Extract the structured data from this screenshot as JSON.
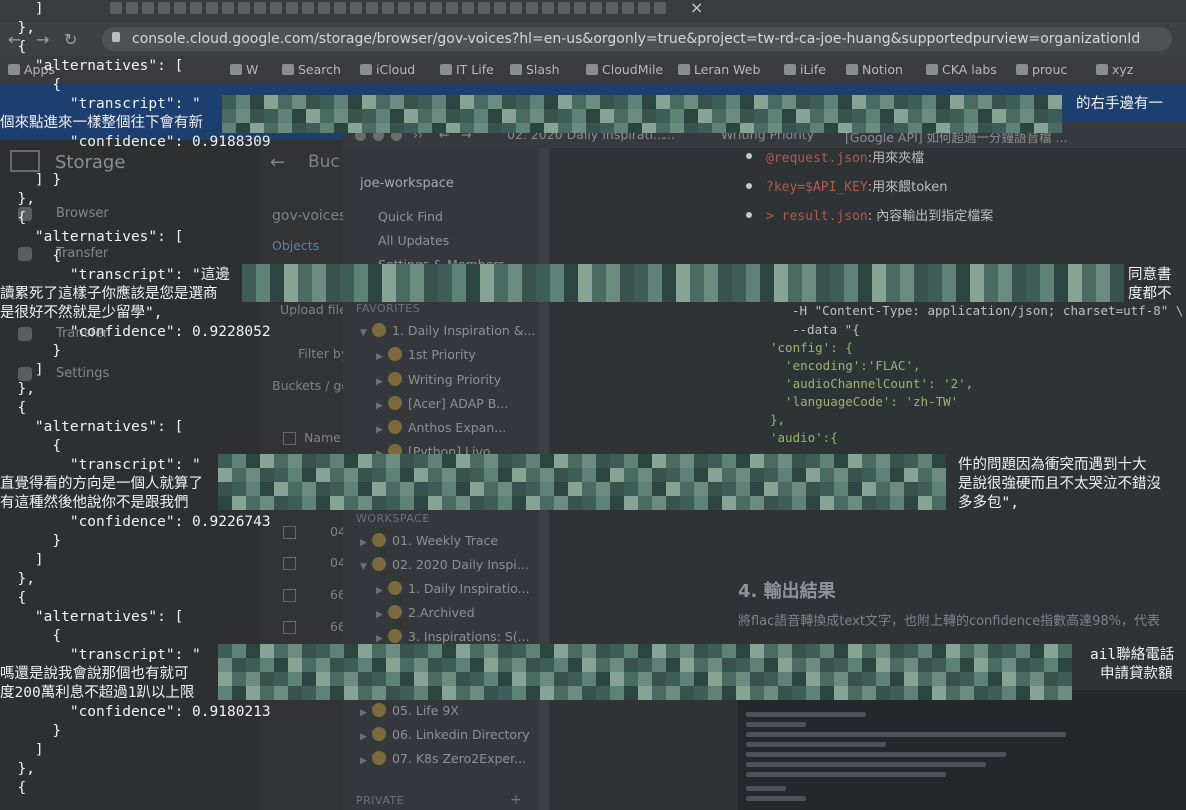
{
  "browser": {
    "url": "console.cloud.google.com/storage/browser/gov-voices?hl=en-us&orgonly=true&project=tw-rd-ca-joe-huang&supportedpurview=organizationId",
    "bookmarks": [
      "Apps",
      "W",
      "Search",
      "iCloud",
      "IT Life",
      "Slash",
      "CloudMile",
      "Leran Web",
      "iLife",
      "Notion",
      "CKA labs",
      "prouc",
      "xyz"
    ]
  },
  "gcs": {
    "title": "Storage",
    "section": "Buc",
    "bucket": "gov-voices",
    "nav": [
      "Browser",
      "Transfer",
      "Transfer",
      "Settings"
    ],
    "tabs": [
      "Objects"
    ],
    "upload": "Upload files",
    "filter": "Filter by",
    "crumb": "Buckets / go",
    "col_name": "Name",
    "rows": [
      "04",
      "04",
      "66",
      "66"
    ]
  },
  "notion": {
    "crumbs": [
      "02. 2020 Daily Inspirati...",
      "...",
      "Writing Priority",
      "[Google API] 如何超過一分鐘語音檔 ..."
    ],
    "workspace": "joe-workspace",
    "links": [
      "Quick Find",
      "All Updates",
      "Settings & Members"
    ],
    "section_favorites": "FAVORITES",
    "section_workspace": "WORKSPACE",
    "section_private": "PRIVATE",
    "tree": [
      "1. Daily Inspiration &...",
      "1st Priority",
      "Writing Priority",
      "[Acer] ADAP B...",
      "Anthos Expan...",
      "[Python] Livo...",
      "01. Weekly Trace",
      "02. 2020 Daily Inspi...",
      "1. Daily Inspiratio...",
      "2.Archived",
      "3. Inspirations: S(...",
      "05. Life 9X",
      "06. Linkedin Directory",
      "07. K8s Zero2Exper..."
    ],
    "bullets": [
      {
        "code": "@request.json",
        "text": ":用來夾檔"
      },
      {
        "code": "?key=$API_KEY",
        "text": ":用來餵token"
      },
      {
        "code": "> result.json",
        "text": ": 內容輸出到指定檔案"
      }
    ],
    "code_lines": [
      "-H \"Content-Type: application/json; charset=utf-8\" \\",
      "--data \"{",
      "'config': {",
      "  'encoding':'FLAC',",
      "  'audioChannelCount': '2',",
      "  'languageCode': 'zh-TW'",
      "},",
      "'audio':{"
    ],
    "heading": "4. 輸出結果",
    "para": "將flac語音轉換成text文字，也附上轉的confidence指數高達98%，代表"
  },
  "terminal": {
    "lines": [
      "    ]",
      "  },",
      "  {",
      "    \"alternatives\": [",
      "      {",
      "        \"transcript\": \"",
      "個來點進來一樣整個往下會有新",
      "        \"confidence\": 0.9188309",
      "      }",
      "    ]",
      "  },",
      "  {",
      "    \"alternatives\": [",
      "      {",
      "        \"transcript\": \"這邊",
      "讀累死了這樣子你應該是您是選商",
      "是很好不然就是少留學\",",
      "        \"confidence\": 0.9228052",
      "      }",
      "    ]",
      "  },",
      "  {",
      "    \"alternatives\": [",
      "      {",
      "        \"transcript\": \"",
      "直覺得看的方向是一個人就算了",
      "有這種然後他說你不是跟我們",
      "        \"confidence\": 0.9226743",
      "      }",
      "    ]",
      "  },",
      "  {",
      "    \"alternatives\": [",
      "      {",
      "        \"transcript\": \"",
      "嗎還是說我會說那個也有就可",
      "度200萬利息不超過1趴以上限",
      "        \"confidence\": 0.9180213",
      "      }",
      "    ]",
      "  },",
      "  {"
    ],
    "fragments": [
      "的右手邊有一",
      "同意書",
      "度都不",
      "件的問題因為衝突而遇到十大",
      "是說很強硬而且不太哭泣不錯沒",
      "多多包\",",
      "ail聯絡電話",
      "申請貸款額"
    ]
  }
}
